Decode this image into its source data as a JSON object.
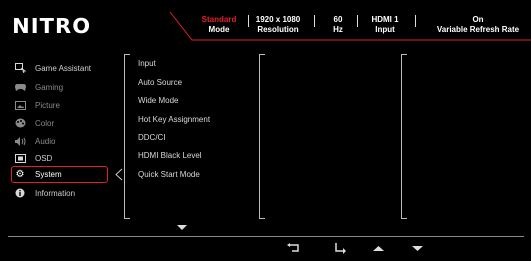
{
  "brand": {
    "logo": "NITRO"
  },
  "header": {
    "mode": {
      "value": "Standard",
      "label": "Mode"
    },
    "resolution": {
      "value": "1920 x 1080",
      "label": "Resolution"
    },
    "refresh": {
      "value": "60",
      "label": "Hz"
    },
    "input": {
      "value": "HDMI 1",
      "label": "Input"
    },
    "vrr": {
      "value": "On",
      "label": "Variable Refresh Rate"
    }
  },
  "sidebar": {
    "items": [
      {
        "label": "Game Assistant",
        "icon": "game-assistant-icon"
      },
      {
        "label": "Gaming",
        "icon": "gamepad-icon"
      },
      {
        "label": "Picture",
        "icon": "picture-icon"
      },
      {
        "label": "Color",
        "icon": "palette-icon"
      },
      {
        "label": "Audio",
        "icon": "speaker-icon"
      },
      {
        "label": "OSD",
        "icon": "osd-icon"
      },
      {
        "label": "System",
        "icon": "gear-icon"
      },
      {
        "label": "Information",
        "icon": "info-icon"
      }
    ],
    "selected": "System"
  },
  "submenu": {
    "items": [
      "Input",
      "Auto Source",
      "Wide Mode",
      "Hot Key Assignment",
      "DDC/CI",
      "HDMI Black Level",
      "Quick Start Mode"
    ]
  },
  "footer": {
    "buttons": [
      "return-icon",
      "enter-icon",
      "up-arrow-icon",
      "down-arrow-icon"
    ]
  },
  "colors": {
    "accent": "#e0202a",
    "background": "#000000",
    "text": "#ffffff",
    "dim": "#8a8a8a"
  }
}
